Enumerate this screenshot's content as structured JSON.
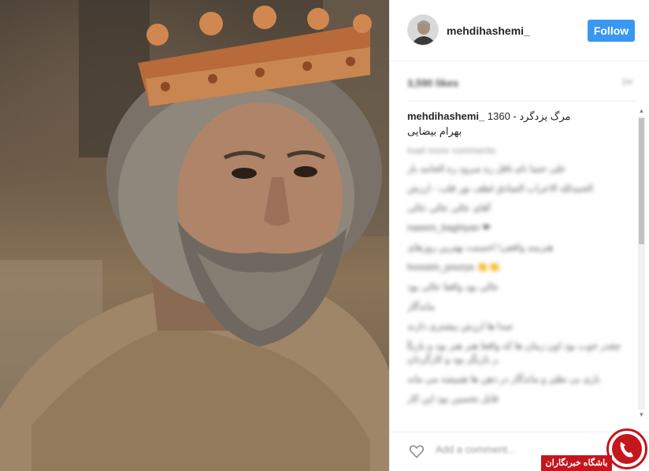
{
  "post": {
    "username": "mehdihashemi_",
    "follow_label": "Follow",
    "likes": "3,590 likes",
    "time_ago": "1w",
    "caption_line1": "مرگ یزدگرد - 1360",
    "caption_line2": "بهرام بیضایی",
    "load_more": "load more comments",
    "add_comment_placeholder": "Add a comment..."
  },
  "comments": [
    "علی حتما نام ناقل ره سرود ره الحامد بار",
    "الحمدلله الاعراب الصادق لطف نور قلب - ارزش",
    "آقای عالی عالی عالی",
    "naeem_baghiyan ❤",
    "هنرمند واقعی! احسنت بهترین روزهای",
    "hossein_pourya 👏👏",
    "عالی بود واقعا عالی بود",
    "ماندگار",
    "صدا ها ارزش بیشتری دارند",
    "چقدر خوب بود اون زمان ها که واقعا هنر هنر بود و بازیگر بازیگر بود و کارگردان",
    "بازی بی نظیر و ماندگار در ذهن ها همیشه می ماند",
    "قابل تحسین بود این کار"
  ],
  "watermark": {
    "text": "باشگاه خبرنگاران"
  },
  "colors": {
    "accent": "#3897f0",
    "watermark_red": "#c4161c"
  }
}
